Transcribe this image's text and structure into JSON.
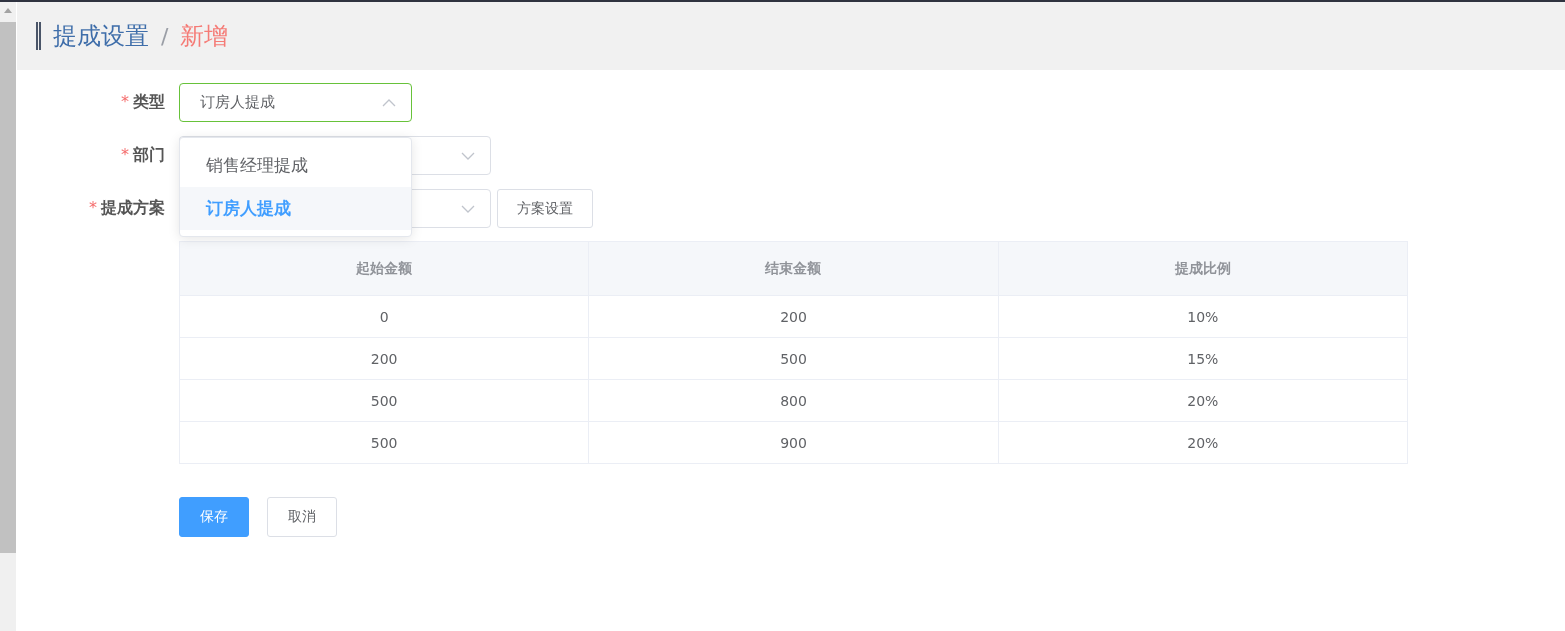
{
  "breadcrumb": {
    "items": [
      {
        "label": "提成设置",
        "current": false
      },
      {
        "label": "新增",
        "current": true
      }
    ],
    "separator": "/"
  },
  "form": {
    "fields": [
      {
        "label": "类型",
        "required_mark": "*",
        "value": "订房人提成",
        "open": true,
        "options": [
          {
            "label": "销售经理提成",
            "selected": false
          },
          {
            "label": "订房人提成",
            "selected": true
          }
        ]
      },
      {
        "label": "部门",
        "required_mark": "*",
        "open": false
      },
      {
        "label": "提成方案",
        "required_mark": "*",
        "open": false,
        "button": "方案设置"
      }
    ]
  },
  "table": {
    "columns": [
      "起始金额",
      "结束金额",
      "提成比例"
    ],
    "rows": [
      [
        "0",
        "200",
        "10%"
      ],
      [
        "200",
        "500",
        "15%"
      ],
      [
        "500",
        "800",
        "20%"
      ],
      [
        "500",
        "900",
        "20%"
      ]
    ]
  },
  "buttons": [
    {
      "label": "保存",
      "kind": "primary"
    },
    {
      "label": "取消",
      "kind": "default"
    }
  ]
}
